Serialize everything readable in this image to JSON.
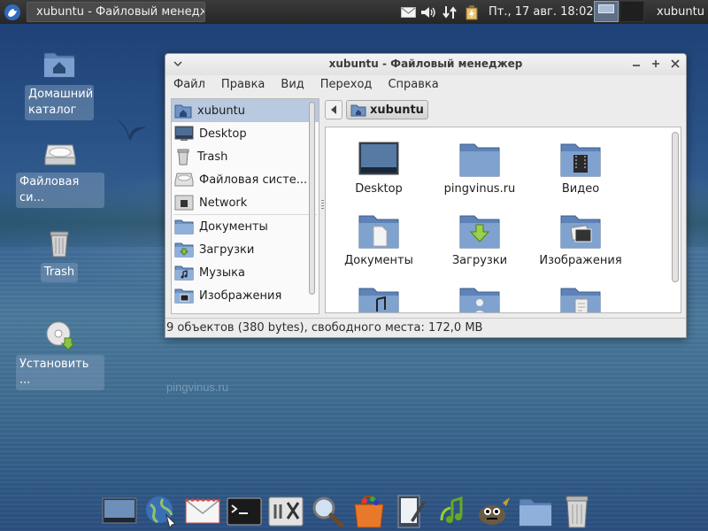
{
  "panel": {
    "task_title": "xubuntu - Файловый менеджер",
    "clock": "Пт., 17 авг.  18:02",
    "user": "xubuntu",
    "tray_icons": [
      "mail-icon",
      "volume-icon",
      "network-icon",
      "battery-icon"
    ]
  },
  "desktop": {
    "icons": [
      {
        "label": "Домашний каталог",
        "icon": "home-folder-icon"
      },
      {
        "label": "Файловая си...",
        "icon": "drive-icon"
      },
      {
        "label": "Trash",
        "icon": "trash-icon"
      },
      {
        "label": "Установить ...",
        "icon": "install-disc-icon"
      }
    ],
    "watermark": "pingvinus.ru"
  },
  "window": {
    "title": "xubuntu - Файловый менеджер",
    "menu": [
      "Файл",
      "Правка",
      "Вид",
      "Переход",
      "Справка"
    ],
    "sidebar": [
      {
        "label": "xubuntu",
        "icon": "home-icon",
        "selected": true
      },
      {
        "label": "Desktop",
        "icon": "desktop-icon"
      },
      {
        "label": "Trash",
        "icon": "trash-icon"
      },
      {
        "label": "Файловая систе...",
        "icon": "drive-icon"
      },
      {
        "label": "Network",
        "icon": "network-icon"
      },
      {
        "label": "Документы",
        "icon": "folder-icon"
      },
      {
        "label": "Загрузки",
        "icon": "folder-download-icon"
      },
      {
        "label": "Музыка",
        "icon": "folder-music-icon"
      },
      {
        "label": "Изображения",
        "icon": "folder-pictures-icon"
      }
    ],
    "path": "xubuntu",
    "files": [
      {
        "label": "Desktop",
        "icon": "desktop-folder-icon"
      },
      {
        "label": "pingvinus.ru",
        "icon": "folder-icon"
      },
      {
        "label": "Видео",
        "icon": "folder-video-icon"
      },
      {
        "label": "Документы",
        "icon": "folder-documents-icon"
      },
      {
        "label": "Загрузки",
        "icon": "folder-download-icon"
      },
      {
        "label": "Изображения",
        "icon": "folder-pictures-icon"
      },
      {
        "label": "",
        "icon": "folder-music-icon"
      },
      {
        "label": "",
        "icon": "folder-public-icon"
      },
      {
        "label": "",
        "icon": "folder-templates-icon"
      }
    ],
    "status": "9 объектов (380 bytes), свободного места: 172,0 MB"
  },
  "dock": {
    "items": [
      "desktop-icon",
      "browser-icon",
      "mail-icon",
      "terminal-icon",
      "settings-icon",
      "search-icon",
      "software-center-icon",
      "text-editor-icon",
      "media-player-icon",
      "gimp-icon",
      "file-manager-icon",
      "trash-icon"
    ]
  },
  "colors": {
    "panel_bg": "#2e2e2e",
    "selection": "#b8c9e0",
    "folder_blue": "#6f93c3"
  }
}
